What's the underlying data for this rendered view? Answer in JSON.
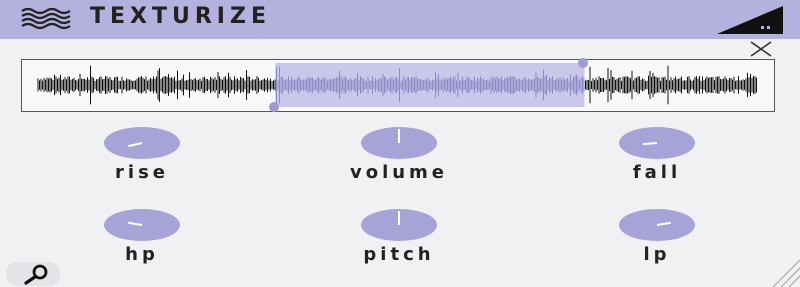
{
  "app": {
    "title": "TEXTURIZE",
    "logo_icon": "waves-icon",
    "level_icon": "level-meter-icon",
    "accent_color": "#b3b1dd",
    "knob_color": "#a6a4d6"
  },
  "controls": {
    "close_icon": "close-icon",
    "search_icon": "magnifier-icon",
    "resize_icon": "resize-grip-icon"
  },
  "waveform": {
    "selection_start": 0.33,
    "selection_end": 0.76,
    "selection_color": "#c9c7ea"
  },
  "knobs": [
    {
      "id": "rise",
      "label": "rise",
      "value": 0.12
    },
    {
      "id": "volume",
      "label": "volume",
      "value": 0.5
    },
    {
      "id": "fall",
      "label": "fall",
      "value": 0.15
    },
    {
      "id": "hp",
      "label": "hp",
      "value": 0.2
    },
    {
      "id": "pitch",
      "label": "pitch",
      "value": 0.5
    },
    {
      "id": "lp",
      "label": "lp",
      "value": 0.8
    }
  ]
}
